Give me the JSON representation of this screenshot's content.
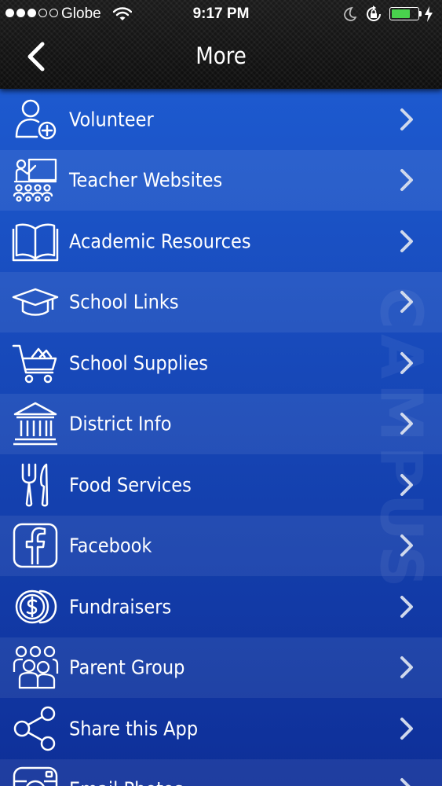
{
  "status_bar": {
    "carrier": "Globe",
    "time": "9:17 PM",
    "battery_level": 0.75,
    "battery_color": "#49d24d"
  },
  "nav": {
    "back_icon": "chevron-left-icon",
    "title": "More"
  },
  "colors": {
    "header": "#141414",
    "list_top": "#1f5fd6",
    "list_bottom": "#0e2f98",
    "text": "#ffffff"
  },
  "menu": {
    "items": [
      {
        "label": "Volunteer",
        "icon": "volunteer-icon"
      },
      {
        "label": "Teacher Websites",
        "icon": "teacher-icon"
      },
      {
        "label": "Academic Resources",
        "icon": "book-icon"
      },
      {
        "label": "School Links",
        "icon": "graduation-cap-icon"
      },
      {
        "label": "School Supplies",
        "icon": "cart-icon"
      },
      {
        "label": "District Info",
        "icon": "building-icon"
      },
      {
        "label": "Food Services",
        "icon": "fork-knife-icon"
      },
      {
        "label": "Facebook",
        "icon": "facebook-icon"
      },
      {
        "label": "Fundraisers",
        "icon": "coins-icon"
      },
      {
        "label": "Parent Group",
        "icon": "group-icon"
      },
      {
        "label": "Share this App",
        "icon": "share-icon"
      },
      {
        "label": "Email Photos",
        "icon": "camera-icon"
      }
    ]
  },
  "watermark": "CAMPUS"
}
